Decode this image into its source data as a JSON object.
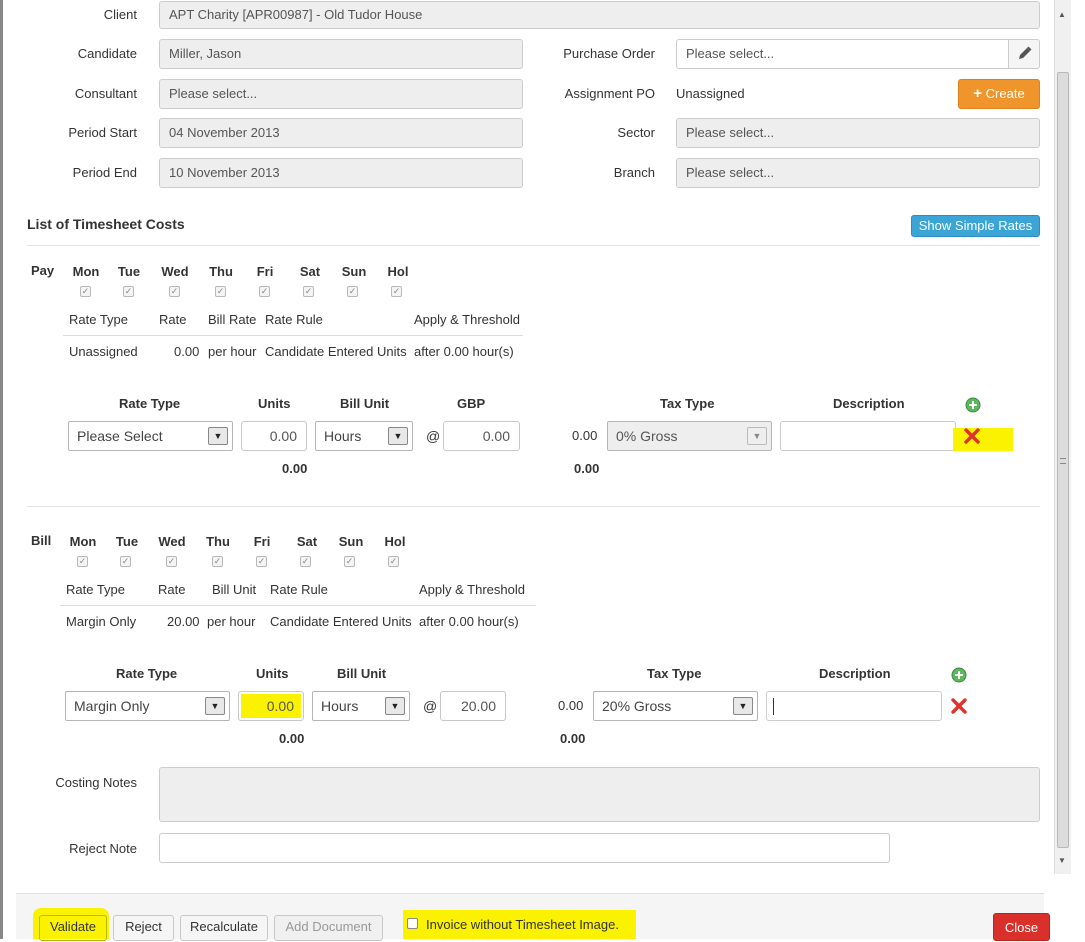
{
  "form": {
    "client_label": "Client",
    "client_value": "APT Charity [APR00987] - Old Tudor House",
    "candidate_label": "Candidate",
    "candidate_value": "Miller, Jason",
    "consultant_label": "Consultant",
    "consultant_value": "Please select...",
    "period_start_label": "Period Start",
    "period_start_value": "04 November 2013",
    "period_end_label": "Period End",
    "period_end_value": "10 November 2013",
    "purchase_order_label": "Purchase Order",
    "purchase_order_value": "Please select...",
    "assignment_po_label": "Assignment PO",
    "assignment_po_value": "Unassigned",
    "create_label": "Create",
    "sector_label": "Sector",
    "sector_value": "Please select...",
    "branch_label": "Branch",
    "branch_value": "Please select..."
  },
  "costs": {
    "title": "List of Timesheet Costs",
    "show_simple_rates": "Show Simple Rates"
  },
  "pay": {
    "label": "Pay",
    "days": [
      "Mon",
      "Tue",
      "Wed",
      "Thu",
      "Fri",
      "Sat",
      "Sun",
      "Hol"
    ],
    "headers": [
      "Rate Type",
      "Rate",
      "Bill Rate",
      "Rate Rule",
      "Apply & Threshold"
    ],
    "row": [
      "Unassigned",
      "0.00",
      "per hour",
      "Candidate Entered Units",
      "after 0.00 hour(s)"
    ],
    "entry_headers": {
      "rate_type": "Rate Type",
      "units": "Units",
      "bill_unit": "Bill Unit",
      "currency": "GBP",
      "tax_type": "Tax Type",
      "description": "Description"
    },
    "entry": {
      "rate_type": "Please Select",
      "units": "0.00",
      "bill_unit": "Hours",
      "at": "@",
      "rate": "0.00",
      "amount": "0.00",
      "tax_type": "0% Gross",
      "description": ""
    },
    "totals": {
      "units": "0.00",
      "amount": "0.00"
    }
  },
  "bill": {
    "label": "Bill",
    "days": [
      "Mon",
      "Tue",
      "Wed",
      "Thu",
      "Fri",
      "Sat",
      "Sun",
      "Hol"
    ],
    "headers": [
      "Rate Type",
      "Rate",
      "Bill Unit",
      "Rate Rule",
      "Apply & Threshold"
    ],
    "row": [
      "Margin Only",
      "20.00",
      "per hour",
      "Candidate Entered Units",
      "after 0.00 hour(s)"
    ],
    "entry_headers": {
      "rate_type": "Rate Type",
      "units": "Units",
      "bill_unit": "Bill Unit",
      "tax_type": "Tax Type",
      "description": "Description"
    },
    "entry": {
      "rate_type": "Margin Only",
      "units": "0.00",
      "bill_unit": "Hours",
      "at": "@",
      "rate": "20.00",
      "amount": "0.00",
      "tax_type": "20% Gross",
      "description": ""
    },
    "totals": {
      "units": "0.00",
      "amount": "0.00"
    }
  },
  "notes": {
    "costing_notes_label": "Costing Notes",
    "reject_note_label": "Reject Note"
  },
  "footer": {
    "validate": "Validate",
    "reject": "Reject",
    "recalculate": "Recalculate",
    "add_document": "Add Document",
    "invoice_without_image": "Invoice without Timesheet Image.",
    "close": "Close"
  },
  "colors": {
    "highlight": "#fbf200",
    "accent_orange": "#f0952b",
    "accent_blue": "#3aa5d6",
    "danger_red": "#d9302c",
    "add_green": "#5cb85c"
  }
}
